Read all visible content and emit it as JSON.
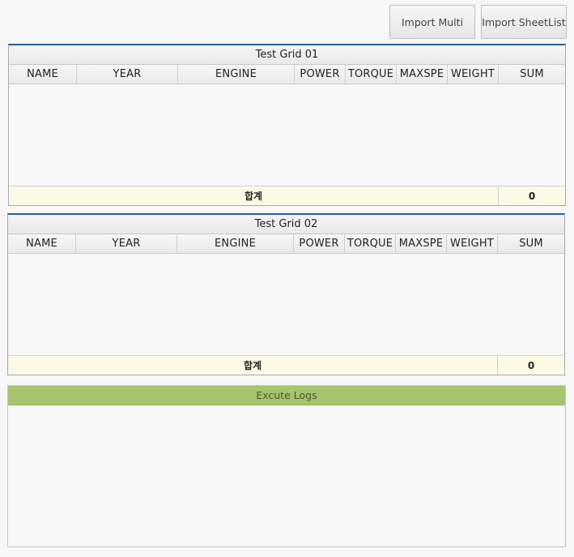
{
  "toolbar": {
    "import_multi_label": "Import Multi",
    "import_sheetlist_label": "Import SheetList"
  },
  "grids": [
    {
      "title": "Test Grid 01",
      "columns": [
        "NAME",
        "YEAR",
        "ENGINE",
        "POWER",
        "TORQUE",
        "MAXSPE",
        "WEIGHT",
        "SUM"
      ],
      "rows": [],
      "footer": {
        "label": "합계",
        "sum": "0"
      }
    },
    {
      "title": "Test Grid 02",
      "columns": [
        "NAME",
        "YEAR",
        "ENGINE",
        "POWER",
        "TORQUE",
        "MAXSPE",
        "WEIGHT",
        "SUM"
      ],
      "rows": [],
      "footer": {
        "label": "합계",
        "sum": "0"
      }
    }
  ],
  "logs": {
    "title": "Excute Logs",
    "entries": []
  },
  "colors": {
    "grid_accent": "#2a5f9e",
    "logs_header": "#a7c46f",
    "footer_bg": "#fcf9e4"
  }
}
